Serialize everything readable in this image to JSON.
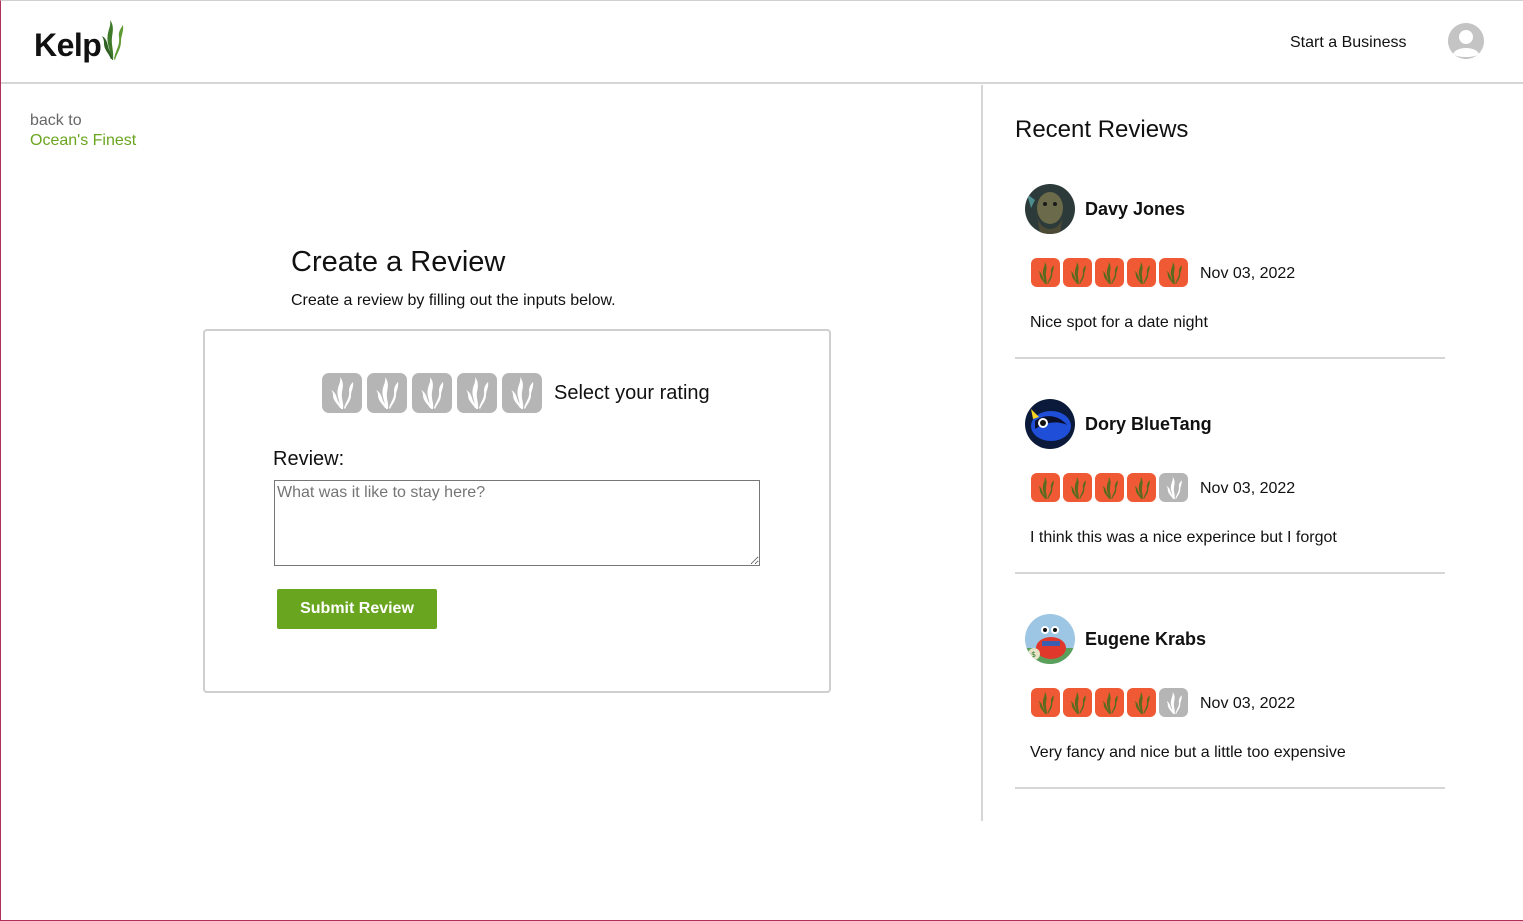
{
  "nav": {
    "logo_text": "Kelp",
    "start_business": "Start a Business"
  },
  "back": {
    "label": "back to",
    "link": "Ocean's Finest"
  },
  "form": {
    "title": "Create a Review",
    "subtitle": "Create a review by filling out the inputs below.",
    "rating_label": "Select your rating",
    "review_label": "Review:",
    "review_placeholder": "What was it like to stay here?",
    "review_value": "",
    "submit_label": "Submit Review",
    "selected_rating": 0,
    "max_rating": 5
  },
  "recent": {
    "title": "Recent Reviews",
    "reviews": [
      {
        "name": "Davy Jones",
        "rating": 5,
        "date": "Nov 03, 2022",
        "text": "Nice spot for a date night"
      },
      {
        "name": "Dory BlueTang",
        "rating": 4,
        "date": "Nov 03, 2022",
        "text": "I think this was a nice experince but I forgot"
      },
      {
        "name": "Eugene Krabs",
        "rating": 4,
        "date": "Nov 03, 2022",
        "text": "Very fancy and nice but a little too expensive"
      }
    ]
  },
  "colors": {
    "brand_green": "#6aa51f",
    "rating_on": "#ef5a35",
    "rating_off": "#b5b5b5"
  },
  "icons": {
    "logo": "kelp-leaf-icon",
    "rating": "kelp-icon",
    "user": "user-avatar-icon"
  }
}
